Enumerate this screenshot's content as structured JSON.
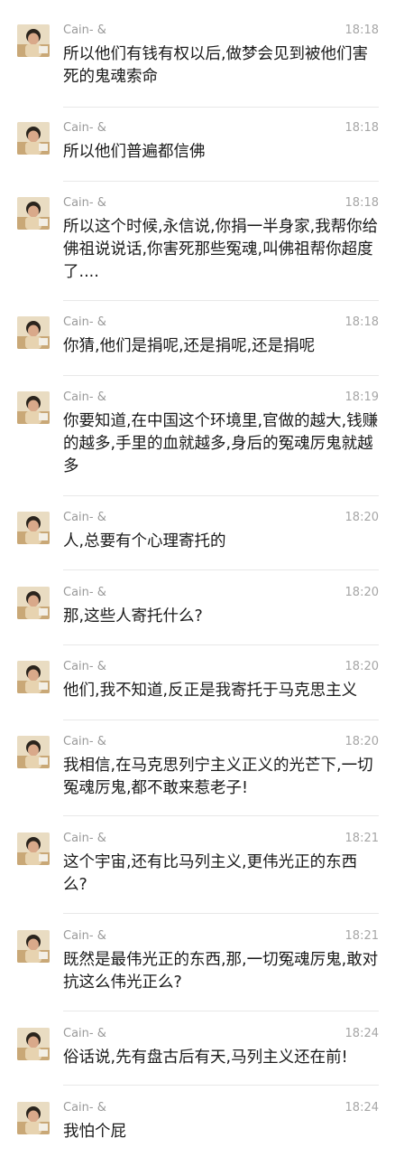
{
  "messages": [
    {
      "sender": "Cain- &",
      "time": "18:18",
      "text": "所以他们有钱有权以后,做梦会见到被他们害死的鬼魂索命"
    },
    {
      "sender": "Cain- &",
      "time": "18:18",
      "text": "所以他们普遍都信佛"
    },
    {
      "sender": "Cain- &",
      "time": "18:18",
      "text": "所以这个时候,永信说,你捐一半身家,我帮你给佛祖说说话,你害死那些冤魂,叫佛祖帮你超度了...."
    },
    {
      "sender": "Cain- &",
      "time": "18:18",
      "text": "你猜,他们是捐呢,还是捐呢,还是捐呢"
    },
    {
      "sender": "Cain- &",
      "time": "18:19",
      "text": "你要知道,在中国这个环境里,官做的越大,钱赚的越多,手里的血就越多,身后的冤魂厉鬼就越多"
    },
    {
      "sender": "Cain- &",
      "time": "18:20",
      "text": "人,总要有个心理寄托的"
    },
    {
      "sender": "Cain- &",
      "time": "18:20",
      "text": "那,这些人寄托什么?"
    },
    {
      "sender": "Cain- &",
      "time": "18:20",
      "text": "他们,我不知道,反正是我寄托于马克思主义"
    },
    {
      "sender": "Cain- &",
      "time": "18:20",
      "text": "我相信,在马克思列宁主义正义的光芒下,一切冤魂厉鬼,都不敢来惹老子!"
    },
    {
      "sender": "Cain- &",
      "time": "18:21",
      "text": "这个宇宙,还有比马列主义,更伟光正的东西么?"
    },
    {
      "sender": "Cain- &",
      "time": "18:21",
      "text": "既然是最伟光正的东西,那,一切冤魂厉鬼,敢对抗这么伟光正么?"
    },
    {
      "sender": "Cain- &",
      "time": "18:24",
      "text": "俗话说,先有盘古后有天,马列主义还在前!"
    },
    {
      "sender": "Cain- &",
      "time": "18:24",
      "text": "我怕个屁"
    }
  ]
}
